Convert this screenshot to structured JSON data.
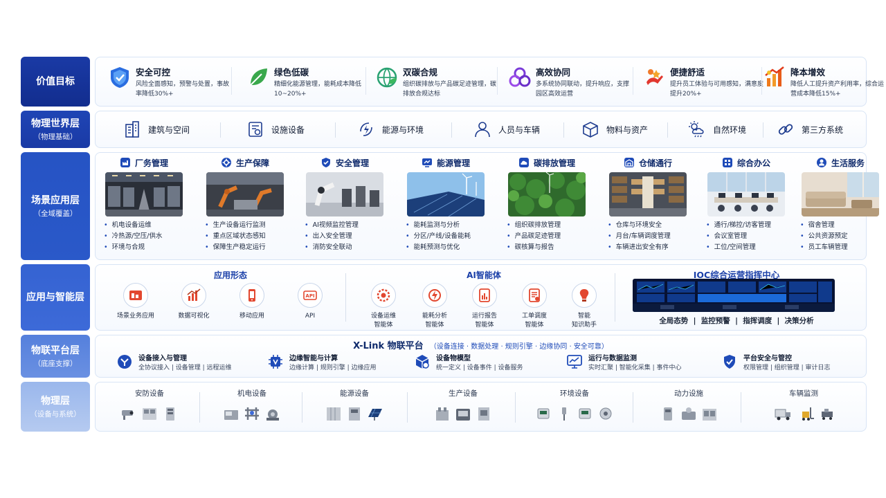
{
  "layers": {
    "value": {
      "title": "价值目标",
      "sub": ""
    },
    "physical_world": {
      "title": "物理世界层",
      "sub": "（物理基础）"
    },
    "scenario": {
      "title": "场景应用层",
      "sub": "（全域覆盖）"
    },
    "app_intel": {
      "title": "应用与智能层",
      "sub": ""
    },
    "iot": {
      "title": "物联平台层",
      "sub": "（底座支撑）"
    },
    "physical": {
      "title": "物理层",
      "sub": "（设备与系统）"
    }
  },
  "value_goals": [
    {
      "icon": "shield-icon",
      "title": "安全可控",
      "desc": "风险全面感知，预警与处置，事故率降低30%+"
    },
    {
      "icon": "leaf-icon",
      "title": "绿色低碳",
      "desc": "精细化能源管理，能耗成本降低10~20%+"
    },
    {
      "icon": "globe-leaf-icon",
      "title": "双碳合规",
      "desc": "组织碳排放与产品碳足迹管理，碳排放合规达标"
    },
    {
      "icon": "collaboration-icon",
      "title": "高效协同",
      "desc": "多系统协同联动，提升响应，支撑园区高效运营"
    },
    {
      "icon": "comfort-icon",
      "title": "便捷舒适",
      "desc": "提升员工体验与可用感知，满意度提升20%+"
    },
    {
      "icon": "cost-down-icon",
      "title": "降本增效",
      "desc": "降低人工提升资产利用率，综合运营成本降低15%+"
    }
  ],
  "physical_world": [
    {
      "icon": "building-icon",
      "label": "建筑与空间"
    },
    {
      "icon": "facility-icon",
      "label": "设施设备"
    },
    {
      "icon": "energy-icon",
      "label": "能源与环境"
    },
    {
      "icon": "person-icon",
      "label": "人员与车辆"
    },
    {
      "icon": "box-icon",
      "label": "物料与资产"
    },
    {
      "icon": "weather-icon",
      "label": "自然环境"
    },
    {
      "icon": "link-icon",
      "label": "第三方系统"
    }
  ],
  "scenarios": [
    {
      "icon": "factory-icon",
      "title": "厂务管理",
      "image": "factory-hall",
      "items": [
        "机电设备运维",
        "冷热源/空压/供水",
        "环境与合规"
      ]
    },
    {
      "icon": "gear-icon",
      "title": "生产保障",
      "image": "robot-line",
      "items": [
        "生产设备运行监测",
        "重点区域状态感知",
        "保障生产稳定运行"
      ]
    },
    {
      "icon": "shield-icon",
      "title": "安全管理",
      "image": "robot-arm",
      "items": [
        "AI视频监控管理",
        "出入安全管理",
        "消防安全联动"
      ]
    },
    {
      "icon": "monitor-icon",
      "title": "能源管理",
      "image": "solar-wind",
      "items": [
        "能耗监测与分析",
        "分区/产线/设备能耗",
        "能耗预测与优化"
      ]
    },
    {
      "icon": "cloud-icon",
      "title": "碳排放管理",
      "image": "forest",
      "items": [
        "组织碳排放管理",
        "产品碳足迹管理",
        "碳核算与报告"
      ]
    },
    {
      "icon": "warehouse-icon",
      "title": "仓储通行",
      "image": "warehouse",
      "items": [
        "仓库与环境安全",
        "月台/车辆调度管理",
        "车辆进出安全有序"
      ]
    },
    {
      "icon": "office-icon",
      "title": "综合办公",
      "image": "office",
      "items": [
        "通行/梯控/访客管理",
        "会议室管理",
        "工位/空间管理"
      ]
    },
    {
      "icon": "service-icon",
      "title": "生活服务",
      "image": "lounge",
      "items": [
        "宿舍管理",
        "公共资源预定",
        "员工车辆管理"
      ]
    }
  ],
  "app_forms": {
    "title": "应用形态",
    "items": [
      {
        "icon": "scene-app-icon",
        "label": "场景业务应用"
      },
      {
        "icon": "chart-icon",
        "label": "数据可视化"
      },
      {
        "icon": "mobile-icon",
        "label": "移动应用"
      },
      {
        "icon": "api-icon",
        "label": "API"
      }
    ]
  },
  "ai_agents": {
    "title": "AI智能体",
    "items": [
      {
        "icon": "ops-gear-icon",
        "label": "设备运维\n智能体"
      },
      {
        "icon": "energy-analysis-icon",
        "label": "能耗分析\n智能体"
      },
      {
        "icon": "report-icon",
        "label": "运行报告\n智能体"
      },
      {
        "icon": "workorder-icon",
        "label": "工单调度\n智能体"
      },
      {
        "icon": "bulb-icon",
        "label": "智能\n知识助手"
      }
    ]
  },
  "ioc": {
    "title": "IOC综合运营指挥中心",
    "image": "command-center",
    "functions": "全局态势  |  监控预警  |  指挥调度  |  决策分析"
  },
  "iot_platform": {
    "title": "X-Link 物联平台",
    "subtitle": "（设备连接 · 数据处理 · 规则引擎 · 边缘协同 · 安全可靠）",
    "items": [
      {
        "icon": "device-access-icon",
        "title": "设备接入与管理",
        "desc": "全协议接入 | 设备管理 | 远程运维"
      },
      {
        "icon": "edge-chip-icon",
        "title": "边缘智能与计算",
        "desc": "边缘计算 | 规则引擎 | 边缘应用"
      },
      {
        "icon": "device-model-icon",
        "title": "设备物模型",
        "desc": "统一定义 | 设备事件 | 设备服务"
      },
      {
        "icon": "data-monitor-icon",
        "title": "运行与数据监测",
        "desc": "实时汇聚 | 智能化采集 | 事件中心"
      },
      {
        "icon": "security-icon",
        "title": "平台安全与管控",
        "desc": "权限管理 | 组织管理 | 审计日志"
      }
    ]
  },
  "physical_layer": [
    {
      "label": "安防设备",
      "devices": [
        "camera-icon",
        "access-panel-icon",
        "cabinet-icon"
      ]
    },
    {
      "label": "机电设备",
      "devices": [
        "generator-icon",
        "pipe-rack-icon",
        "pump-icon"
      ]
    },
    {
      "label": "能源设备",
      "devices": [
        "switchgear-icon",
        "meter-cabinet-icon",
        "solar-panel-icon"
      ]
    },
    {
      "label": "生产设备",
      "devices": [
        "production-machine-icon",
        "cnc-icon",
        "press-icon"
      ]
    },
    {
      "label": "环境设备",
      "devices": [
        "env-sensor-icon",
        "probe-icon",
        "air-monitor-icon",
        "smoke-detector-icon"
      ]
    },
    {
      "label": "动力设施",
      "devices": [
        "boiler-icon",
        "compressor-icon",
        "chiller-icon"
      ]
    },
    {
      "label": "车辆监测",
      "devices": [
        "truck-icon",
        "forklift-icon",
        "cart-icon"
      ]
    }
  ],
  "colors": {
    "label_dark": "#1437a3",
    "label_mid": "#3d6ad8",
    "label_light": "#b5caf0",
    "accent": "#1f4bb8"
  }
}
